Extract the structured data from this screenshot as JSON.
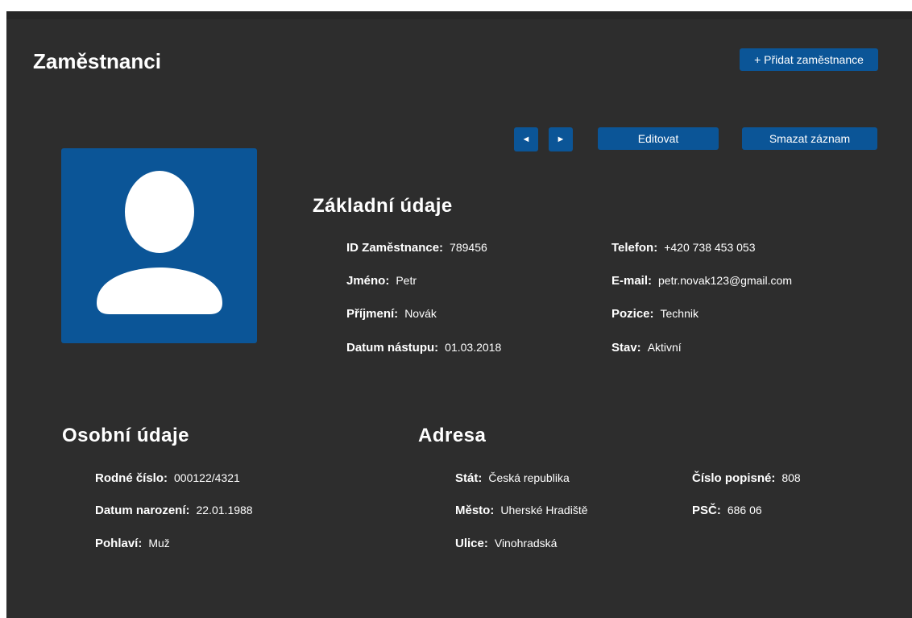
{
  "header": {
    "title": "Zaměstnanci",
    "add_button_label": "+ Přidat zaměstnance"
  },
  "toolbar": {
    "prev_label": "◄",
    "next_label": "►",
    "edit_label": "Editovat",
    "delete_label": "Smazat záznam"
  },
  "avatar": {
    "icon": "user-placeholder-icon",
    "background_color": "#0b5597"
  },
  "basic": {
    "title": "Základní údaje",
    "id": {
      "label": "ID Zaměstnance:",
      "value": "789456"
    },
    "first_name": {
      "label": "Jméno:",
      "value": "Petr"
    },
    "last_name": {
      "label": "Příjmení:",
      "value": "Novák"
    },
    "start_date": {
      "label": "Datum nástupu:",
      "value": "01.03.2018"
    },
    "phone": {
      "label": "Telefon:",
      "value": "+420 738 453 053"
    },
    "email": {
      "label": "E-mail:",
      "value": "petr.novak123@gmail.com"
    },
    "position": {
      "label": "Pozice:",
      "value": "Technik"
    },
    "status": {
      "label": "Stav:",
      "value": "Aktivní"
    }
  },
  "personal": {
    "title": "Osobní údaje",
    "birth_number": {
      "label": "Rodné číslo:",
      "value": "000122/4321"
    },
    "birth_date": {
      "label": "Datum narození:",
      "value": "22.01.1988"
    },
    "gender": {
      "label": "Pohlaví:",
      "value": "Muž"
    }
  },
  "address": {
    "title": "Adresa",
    "country": {
      "label": "Stát:",
      "value": "Česká republika"
    },
    "city": {
      "label": "Město:",
      "value": "Uherské Hradiště"
    },
    "street": {
      "label": "Ulice:",
      "value": "Vinohradská"
    },
    "house_number": {
      "label": "Číslo popisné:",
      "value": "808"
    },
    "zip": {
      "label": "PSČ:",
      "value": "686 06"
    }
  },
  "colors": {
    "background": "#2d2d2d",
    "accent": "#0b5597",
    "text": "#ffffff"
  }
}
